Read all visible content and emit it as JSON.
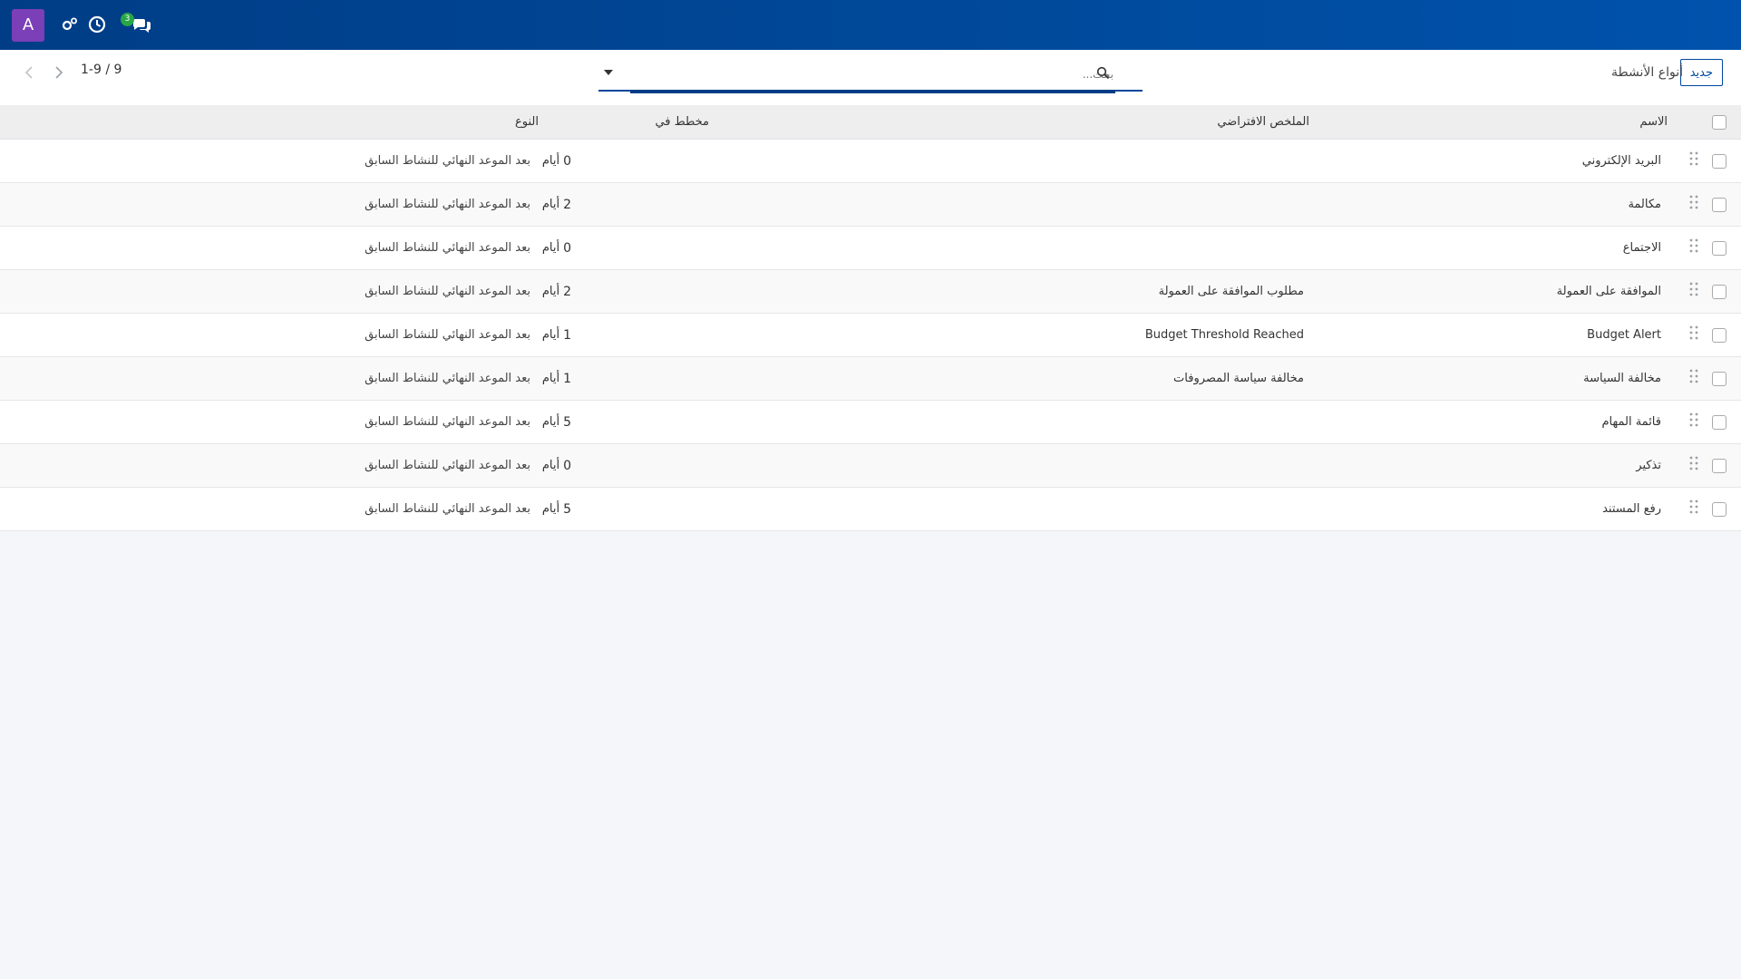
{
  "navbar": {
    "avatar_letter": "A",
    "badge_count": "3",
    "brand_color": "#004a9c"
  },
  "control": {
    "new_label": "جديد",
    "page_title": "أنواع الأنشطة",
    "search_placeholder": "بحث...",
    "pager": "1-9 / 9"
  },
  "table": {
    "headers": {
      "name": "الاسم",
      "summary": "الملخص الافتراضي",
      "planned": "مخطط في",
      "type": "النوع"
    },
    "rows": [
      {
        "name": "البريد الإلكتروني",
        "summary": "",
        "days": "0",
        "unit": "أيام",
        "type": "بعد الموعد النهائي للنشاط السابق"
      },
      {
        "name": "مكالمة",
        "summary": "",
        "days": "2",
        "unit": "أيام",
        "type": "بعد الموعد النهائي للنشاط السابق"
      },
      {
        "name": "الاجتماع",
        "summary": "",
        "days": "0",
        "unit": "أيام",
        "type": "بعد الموعد النهائي للنشاط السابق"
      },
      {
        "name": "الموافقة على العمولة",
        "summary": "مطلوب الموافقة على العمولة",
        "days": "2",
        "unit": "أيام",
        "type": "بعد الموعد النهائي للنشاط السابق"
      },
      {
        "name": "Budget Alert",
        "summary": "Budget Threshold Reached",
        "days": "1",
        "unit": "أيام",
        "type": "بعد الموعد النهائي للنشاط السابق"
      },
      {
        "name": "مخالفة السياسة",
        "summary": "مخالفة سياسة المصروفات",
        "days": "1",
        "unit": "أيام",
        "type": "بعد الموعد النهائي للنشاط السابق"
      },
      {
        "name": "قائمة المهام",
        "summary": "",
        "days": "5",
        "unit": "أيام",
        "type": "بعد الموعد النهائي للنشاط السابق"
      },
      {
        "name": "تذكير",
        "summary": "",
        "days": "0",
        "unit": "أيام",
        "type": "بعد الموعد النهائي للنشاط السابق"
      },
      {
        "name": "رفع المستند",
        "summary": "",
        "days": "5",
        "unit": "أيام",
        "type": "بعد الموعد النهائي للنشاط السابق"
      }
    ]
  }
}
